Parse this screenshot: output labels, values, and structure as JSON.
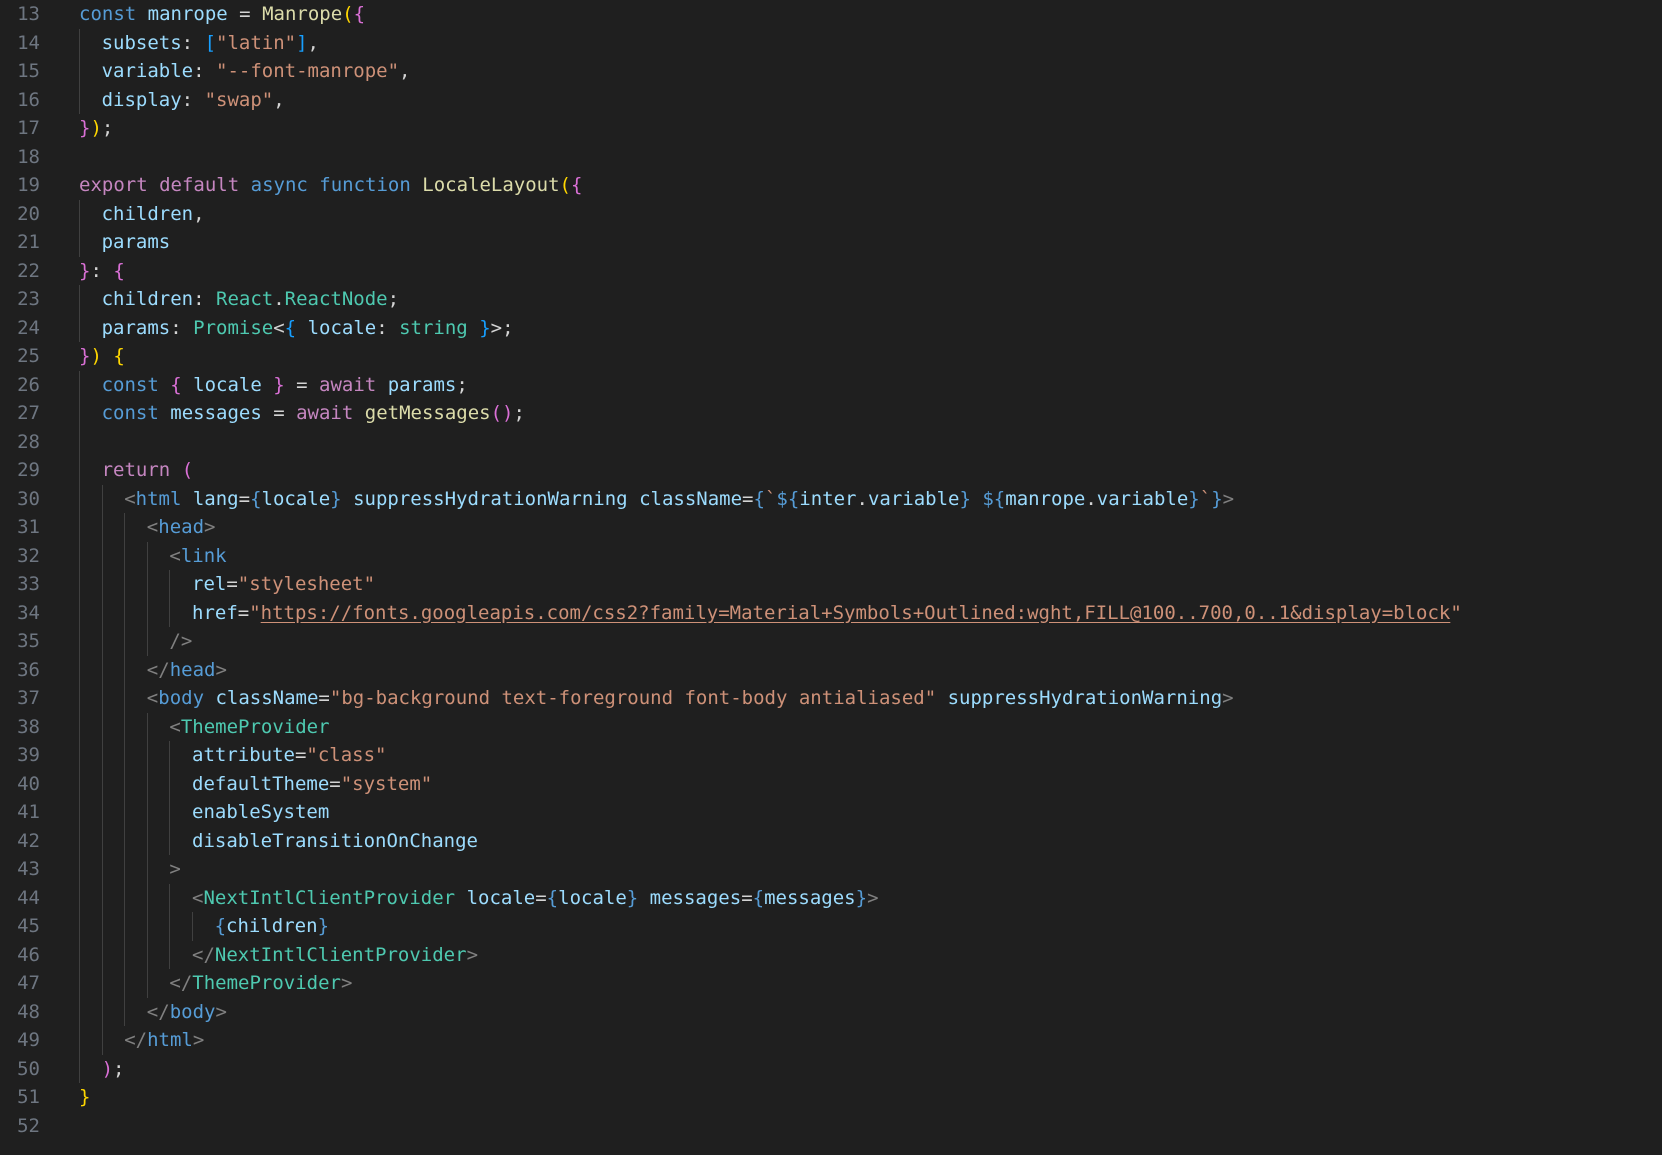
{
  "editor": {
    "lines": [
      {
        "n": "13",
        "indent": 0,
        "tokens": [
          [
            "const",
            "kw"
          ],
          [
            " ",
            "plain"
          ],
          [
            "manrope",
            "var"
          ],
          [
            " = ",
            "plain"
          ],
          [
            "Manrope",
            "fn"
          ],
          [
            "(",
            "b1"
          ],
          [
            "{",
            "b2"
          ]
        ]
      },
      {
        "n": "14",
        "indent": 1,
        "tokens": [
          [
            "subsets",
            "var"
          ],
          [
            ": ",
            "plain"
          ],
          [
            "[",
            "b3"
          ],
          [
            "\"latin\"",
            "str"
          ],
          [
            "]",
            "b3"
          ],
          [
            ",",
            "plain"
          ]
        ]
      },
      {
        "n": "15",
        "indent": 1,
        "tokens": [
          [
            "variable",
            "var"
          ],
          [
            ": ",
            "plain"
          ],
          [
            "\"--font-manrope\"",
            "str"
          ],
          [
            ",",
            "plain"
          ]
        ]
      },
      {
        "n": "16",
        "indent": 1,
        "tokens": [
          [
            "display",
            "var"
          ],
          [
            ": ",
            "plain"
          ],
          [
            "\"swap\"",
            "str"
          ],
          [
            ",",
            "plain"
          ]
        ]
      },
      {
        "n": "17",
        "indent": 0,
        "tokens": [
          [
            "}",
            "b2"
          ],
          [
            ")",
            "b1"
          ],
          [
            ";",
            "plain"
          ]
        ]
      },
      {
        "n": "18",
        "indent": 0,
        "tokens": []
      },
      {
        "n": "19",
        "indent": 0,
        "tokens": [
          [
            "export",
            "ctl"
          ],
          [
            " ",
            "plain"
          ],
          [
            "default",
            "ctl"
          ],
          [
            " ",
            "plain"
          ],
          [
            "async",
            "kw"
          ],
          [
            " ",
            "plain"
          ],
          [
            "function",
            "kw"
          ],
          [
            " ",
            "plain"
          ],
          [
            "LocaleLayout",
            "fn"
          ],
          [
            "(",
            "b1"
          ],
          [
            "{",
            "b2"
          ]
        ]
      },
      {
        "n": "20",
        "indent": 1,
        "tokens": [
          [
            "children",
            "var"
          ],
          [
            ",",
            "plain"
          ]
        ]
      },
      {
        "n": "21",
        "indent": 1,
        "tokens": [
          [
            "params",
            "var"
          ]
        ]
      },
      {
        "n": "22",
        "indent": 0,
        "tokens": [
          [
            "}",
            "b2"
          ],
          [
            ": ",
            "plain"
          ],
          [
            "{",
            "b2"
          ]
        ]
      },
      {
        "n": "23",
        "indent": 1,
        "tokens": [
          [
            "children",
            "var"
          ],
          [
            ": ",
            "plain"
          ],
          [
            "React",
            "type"
          ],
          [
            ".",
            "plain"
          ],
          [
            "ReactNode",
            "type"
          ],
          [
            ";",
            "plain"
          ]
        ]
      },
      {
        "n": "24",
        "indent": 1,
        "tokens": [
          [
            "params",
            "var"
          ],
          [
            ": ",
            "plain"
          ],
          [
            "Promise",
            "type"
          ],
          [
            "<",
            "plain"
          ],
          [
            "{",
            "b3"
          ],
          [
            " ",
            "plain"
          ],
          [
            "locale",
            "var"
          ],
          [
            ": ",
            "plain"
          ],
          [
            "string",
            "type"
          ],
          [
            " ",
            "plain"
          ],
          [
            "}",
            "b3"
          ],
          [
            ">",
            "plain"
          ],
          [
            ";",
            "plain"
          ]
        ]
      },
      {
        "n": "25",
        "indent": 0,
        "tokens": [
          [
            "}",
            "b2"
          ],
          [
            ")",
            "b1"
          ],
          [
            " ",
            "plain"
          ],
          [
            "{",
            "b1"
          ]
        ]
      },
      {
        "n": "26",
        "indent": 1,
        "tokens": [
          [
            "const",
            "kw"
          ],
          [
            " ",
            "plain"
          ],
          [
            "{",
            "b2"
          ],
          [
            " ",
            "plain"
          ],
          [
            "locale",
            "var"
          ],
          [
            " ",
            "plain"
          ],
          [
            "}",
            "b2"
          ],
          [
            " = ",
            "plain"
          ],
          [
            "await",
            "ctl"
          ],
          [
            " ",
            "plain"
          ],
          [
            "params",
            "var"
          ],
          [
            ";",
            "plain"
          ]
        ]
      },
      {
        "n": "27",
        "indent": 1,
        "tokens": [
          [
            "const",
            "kw"
          ],
          [
            " ",
            "plain"
          ],
          [
            "messages",
            "var"
          ],
          [
            " = ",
            "plain"
          ],
          [
            "await",
            "ctl"
          ],
          [
            " ",
            "plain"
          ],
          [
            "getMessages",
            "fn"
          ],
          [
            "(",
            "b2"
          ],
          [
            ")",
            "b2"
          ],
          [
            ";",
            "plain"
          ]
        ]
      },
      {
        "n": "28",
        "indent": 1,
        "tokens": []
      },
      {
        "n": "29",
        "indent": 1,
        "tokens": [
          [
            "return",
            "ctl"
          ],
          [
            " ",
            "plain"
          ],
          [
            "(",
            "b2"
          ]
        ]
      },
      {
        "n": "30",
        "indent": 2,
        "tokens": [
          [
            "<",
            "punct"
          ],
          [
            "html",
            "tag"
          ],
          [
            " ",
            "plain"
          ],
          [
            "lang",
            "attr"
          ],
          [
            "=",
            "plain"
          ],
          [
            "{",
            "kw"
          ],
          [
            "locale",
            "var"
          ],
          [
            "}",
            "kw"
          ],
          [
            " ",
            "plain"
          ],
          [
            "suppressHydrationWarning",
            "attr"
          ],
          [
            " ",
            "plain"
          ],
          [
            "className",
            "attr"
          ],
          [
            "=",
            "plain"
          ],
          [
            "{",
            "kw"
          ],
          [
            "`",
            "str"
          ],
          [
            "${",
            "kw"
          ],
          [
            "inter",
            "var"
          ],
          [
            ".",
            "plain"
          ],
          [
            "variable",
            "var"
          ],
          [
            "}",
            "kw"
          ],
          [
            " ",
            "str"
          ],
          [
            "${",
            "kw"
          ],
          [
            "manrope",
            "var"
          ],
          [
            ".",
            "plain"
          ],
          [
            "variable",
            "var"
          ],
          [
            "}",
            "kw"
          ],
          [
            "`",
            "str"
          ],
          [
            "}",
            "kw"
          ],
          [
            ">",
            "punct"
          ]
        ]
      },
      {
        "n": "31",
        "indent": 3,
        "tokens": [
          [
            "<",
            "punct"
          ],
          [
            "head",
            "tag"
          ],
          [
            ">",
            "punct"
          ]
        ]
      },
      {
        "n": "32",
        "indent": 4,
        "tokens": [
          [
            "<",
            "punct"
          ],
          [
            "link",
            "tag"
          ]
        ]
      },
      {
        "n": "33",
        "indent": 5,
        "tokens": [
          [
            "rel",
            "attr"
          ],
          [
            "=",
            "plain"
          ],
          [
            "\"stylesheet\"",
            "str"
          ]
        ]
      },
      {
        "n": "34",
        "indent": 5,
        "tokens": [
          [
            "href",
            "attr"
          ],
          [
            "=",
            "plain"
          ],
          [
            "\"",
            "str"
          ],
          [
            "https://fonts.googleapis.com/css2?family=Material+Symbols+Outlined:wght,FILL@100..700,0..1&display=block",
            "link"
          ],
          [
            "\"",
            "str"
          ]
        ]
      },
      {
        "n": "35",
        "indent": 4,
        "tokens": [
          [
            "/>",
            "punct"
          ]
        ]
      },
      {
        "n": "36",
        "indent": 3,
        "tokens": [
          [
            "</",
            "punct"
          ],
          [
            "head",
            "tag"
          ],
          [
            ">",
            "punct"
          ]
        ]
      },
      {
        "n": "37",
        "indent": 3,
        "tokens": [
          [
            "<",
            "punct"
          ],
          [
            "body",
            "tag"
          ],
          [
            " ",
            "plain"
          ],
          [
            "className",
            "attr"
          ],
          [
            "=",
            "plain"
          ],
          [
            "\"bg-background text-foreground font-body antialiased\"",
            "str"
          ],
          [
            " ",
            "plain"
          ],
          [
            "suppressHydrationWarning",
            "attr"
          ],
          [
            ">",
            "punct"
          ]
        ]
      },
      {
        "n": "38",
        "indent": 4,
        "tokens": [
          [
            "<",
            "punct"
          ],
          [
            "ThemeProvider",
            "cmp"
          ]
        ]
      },
      {
        "n": "39",
        "indent": 5,
        "tokens": [
          [
            "attribute",
            "attr"
          ],
          [
            "=",
            "plain"
          ],
          [
            "\"class\"",
            "str"
          ]
        ]
      },
      {
        "n": "40",
        "indent": 5,
        "tokens": [
          [
            "defaultTheme",
            "attr"
          ],
          [
            "=",
            "plain"
          ],
          [
            "\"system\"",
            "str"
          ]
        ]
      },
      {
        "n": "41",
        "indent": 5,
        "tokens": [
          [
            "enableSystem",
            "attr"
          ]
        ]
      },
      {
        "n": "42",
        "indent": 5,
        "tokens": [
          [
            "disableTransitionOnChange",
            "attr"
          ]
        ]
      },
      {
        "n": "43",
        "indent": 4,
        "tokens": [
          [
            ">",
            "punct"
          ]
        ]
      },
      {
        "n": "44",
        "indent": 5,
        "tokens": [
          [
            "<",
            "punct"
          ],
          [
            "NextIntlClientProvider",
            "cmp"
          ],
          [
            " ",
            "plain"
          ],
          [
            "locale",
            "attr"
          ],
          [
            "=",
            "plain"
          ],
          [
            "{",
            "kw"
          ],
          [
            "locale",
            "var"
          ],
          [
            "}",
            "kw"
          ],
          [
            " ",
            "plain"
          ],
          [
            "messages",
            "attr"
          ],
          [
            "=",
            "plain"
          ],
          [
            "{",
            "kw"
          ],
          [
            "messages",
            "var"
          ],
          [
            "}",
            "kw"
          ],
          [
            ">",
            "punct"
          ]
        ]
      },
      {
        "n": "45",
        "indent": 6,
        "tokens": [
          [
            "{",
            "kw"
          ],
          [
            "children",
            "var"
          ],
          [
            "}",
            "kw"
          ]
        ]
      },
      {
        "n": "46",
        "indent": 5,
        "tokens": [
          [
            "</",
            "punct"
          ],
          [
            "NextIntlClientProvider",
            "cmp"
          ],
          [
            ">",
            "punct"
          ]
        ]
      },
      {
        "n": "47",
        "indent": 4,
        "tokens": [
          [
            "</",
            "punct"
          ],
          [
            "ThemeProvider",
            "cmp"
          ],
          [
            ">",
            "punct"
          ]
        ]
      },
      {
        "n": "48",
        "indent": 3,
        "tokens": [
          [
            "</",
            "punct"
          ],
          [
            "body",
            "tag"
          ],
          [
            ">",
            "punct"
          ]
        ]
      },
      {
        "n": "49",
        "indent": 2,
        "tokens": [
          [
            "</",
            "punct"
          ],
          [
            "html",
            "tag"
          ],
          [
            ">",
            "punct"
          ]
        ]
      },
      {
        "n": "50",
        "indent": 1,
        "tokens": [
          [
            ")",
            "b2"
          ],
          [
            ";",
            "plain"
          ]
        ]
      },
      {
        "n": "51",
        "indent": 0,
        "tokens": [
          [
            "}",
            "b1"
          ]
        ]
      },
      {
        "n": "52",
        "indent": 0,
        "tokens": []
      }
    ]
  },
  "colors": {
    "background": "#1f1f1f",
    "line_number": "#6e7681",
    "indent_guide": "#404040"
  }
}
